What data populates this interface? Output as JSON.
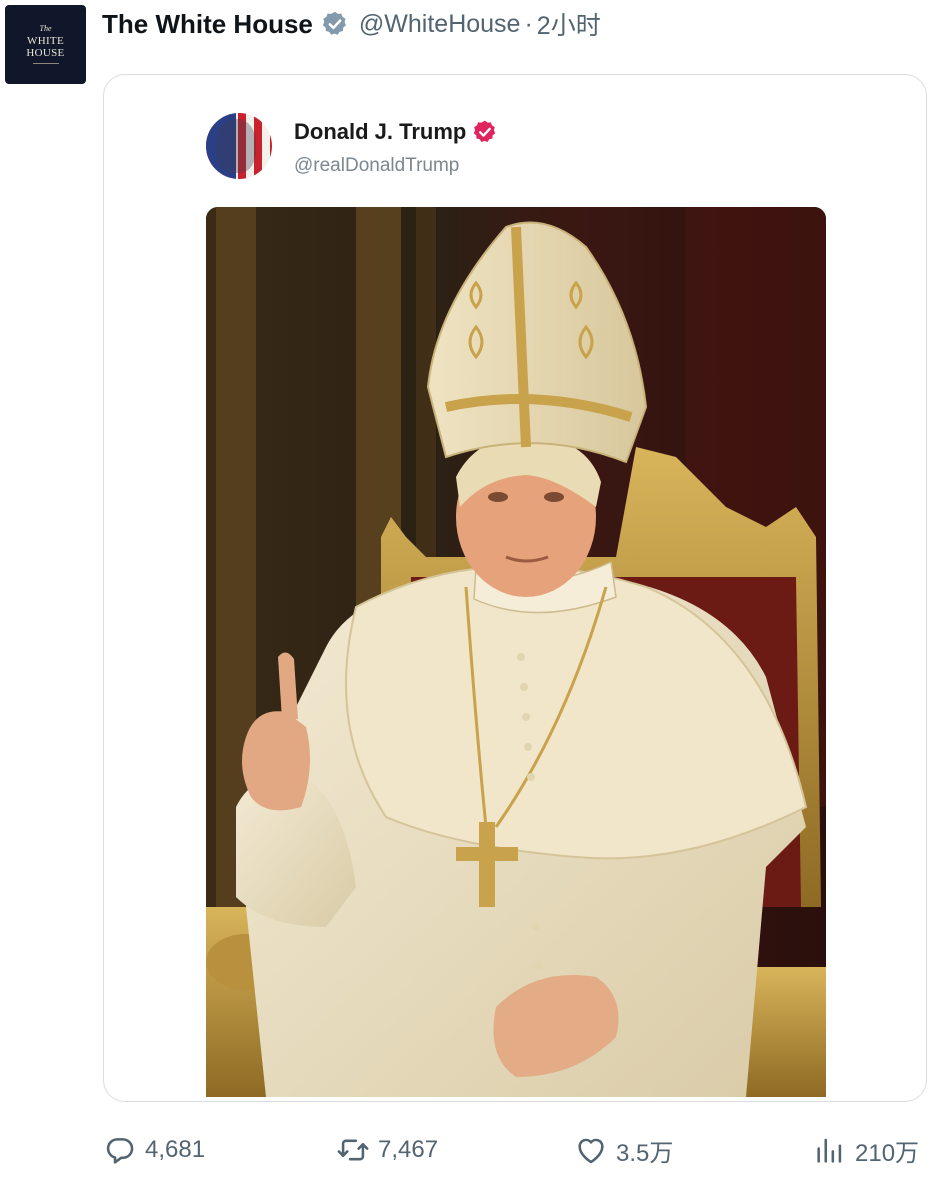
{
  "author": {
    "avatar_text": {
      "the": "The",
      "line1": "WHITE",
      "line2": "HOUSE"
    },
    "display_name": "The White House",
    "handle": "@WhiteHouse",
    "separator": "·",
    "time": "2小时",
    "verified_color": "#829aab"
  },
  "quoted": {
    "display_name": "Donald J. Trump",
    "handle": "@realDonaldTrump",
    "verified_color": "#e0245e",
    "image_icon": "portrait-image"
  },
  "actions": {
    "reply": {
      "icon": "reply-icon",
      "count": "4,681"
    },
    "retweet": {
      "icon": "retweet-icon",
      "count": "7,467"
    },
    "like": {
      "icon": "heart-icon",
      "count": "3.5万"
    },
    "views": {
      "icon": "views-icon",
      "count": "210万"
    }
  },
  "colors": {
    "text_primary": "#0f1419",
    "text_secondary": "#536471",
    "card_border": "#d9dde1"
  }
}
